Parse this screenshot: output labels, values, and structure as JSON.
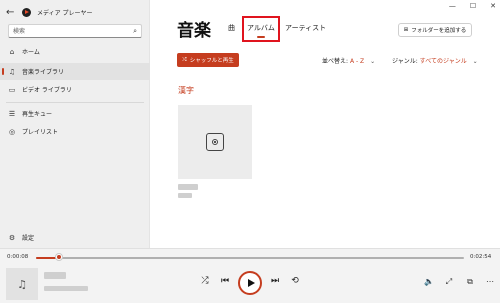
{
  "app": {
    "title": "メディア プレーヤー",
    "back_glyph": "←",
    "window_controls": {
      "minimize": "—",
      "maximize": "☐",
      "close": "✕"
    }
  },
  "search": {
    "placeholder": "検索",
    "icon": "search-icon",
    "icon_glyph": "⌕"
  },
  "sidebar": {
    "items": [
      {
        "label": "ホーム",
        "icon": "home-icon",
        "glyph": "⌂"
      },
      {
        "label": "音楽ライブラリ",
        "icon": "music-note-icon",
        "glyph": "♫"
      },
      {
        "label": "ビデオ ライブラリ",
        "icon": "video-icon",
        "glyph": "▭"
      },
      {
        "label": "再生キュー",
        "icon": "queue-icon",
        "glyph": "☰"
      },
      {
        "label": "プレイリスト",
        "icon": "playlist-icon",
        "glyph": "◎"
      }
    ],
    "settings": {
      "label": "設定",
      "icon": "gear-icon",
      "glyph": "⚙"
    }
  },
  "main": {
    "title": "音楽",
    "tabs": [
      {
        "label": "曲"
      },
      {
        "label": "アルバム"
      },
      {
        "label": "アーティスト"
      }
    ],
    "add_folder": {
      "label": "フォルダーを追加する",
      "glyph": "⊞"
    },
    "shuffle": {
      "label": "シャッフルと再生",
      "glyph": "⤮"
    },
    "sort": {
      "label": "並べ替え:",
      "value": "A - Z",
      "chevron": "⌄"
    },
    "genre": {
      "label": "ジャンル:",
      "value": "すべてのジャンル",
      "chevron": "⌄"
    },
    "group_header": "漢字"
  },
  "player": {
    "elapsed": "0:00:08",
    "total": "0:02:54",
    "progress_fraction": 0.05,
    "glyphs": {
      "art": "♫",
      "shuffle": "⤮",
      "previous": "⏮",
      "next": "⏭",
      "repeat": "⟲",
      "volume": "🔈",
      "cast": "⤢",
      "miniplayer": "⧉",
      "more": "⋯"
    }
  },
  "colors": {
    "accent": "#c53d1f",
    "highlight_box": "#e0141e",
    "sidebar_bg": "#efefef"
  }
}
